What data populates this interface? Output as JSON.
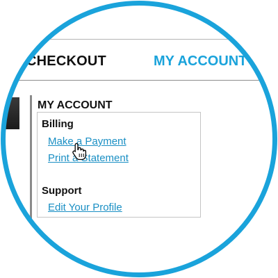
{
  "nav": {
    "checkout_label": "CHECKOUT",
    "my_account_label": "MY ACCOUNT"
  },
  "account_panel": {
    "title": "MY ACCOUNT",
    "billing": {
      "heading": "Billing",
      "links": [
        "Make a Payment",
        "Print a Statement"
      ]
    },
    "support": {
      "heading": "Support",
      "links": [
        "Edit Your Profile"
      ]
    }
  },
  "icons": {
    "cursor": "hand-pointer-icon"
  },
  "colors": {
    "accent": "#1aa3db",
    "link": "#1a8fc4",
    "text": "#111111"
  }
}
